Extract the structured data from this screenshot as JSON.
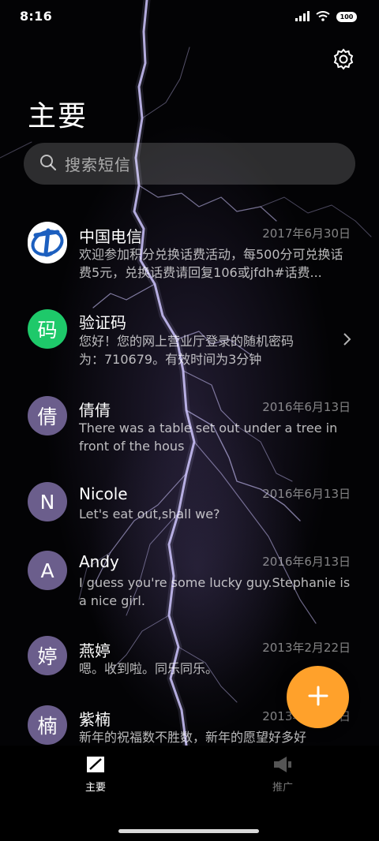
{
  "status_bar": {
    "time": "8:16",
    "battery": "100"
  },
  "header": {
    "title": "主要"
  },
  "search": {
    "placeholder": "搜索短信"
  },
  "messages": [
    {
      "sender": "中国电信",
      "date": "2017年6月30日",
      "preview": "欢迎参加积分兑换话费活动，每500分可兑换话费5元，兑换话费请回复106或jfdh#话费...",
      "avatar_icon": "china-telecom-logo",
      "avatar_color": "#ffffff"
    },
    {
      "sender": "验证码",
      "date": "",
      "preview": "您好！您的网上营业厅登录的随机密码为：710679。有效时间为3分钟",
      "avatar_text": "码",
      "avatar_color": "#1ec96a"
    },
    {
      "sender": "倩倩",
      "date": "2016年6月13日",
      "preview": "There was a table set out under a tree in front of the hous",
      "avatar_text": "倩",
      "avatar_color": "#6b5e8c"
    },
    {
      "sender": "Nicole",
      "date": "2016年6月13日",
      "preview": "Let's eat out,shall we?",
      "avatar_text": "N",
      "avatar_color": "#6b5e8c"
    },
    {
      "sender": "Andy",
      "date": "2016年6月13日",
      "preview": "I guess you're some lucky guy.Stephanie is a nice girl.",
      "avatar_text": "A",
      "avatar_color": "#6b5e8c"
    },
    {
      "sender": "燕婷",
      "date": "2013年2月22日",
      "preview": "嗯。收到啦。同乐同乐。",
      "avatar_text": "婷",
      "avatar_color": "#6b5e8c"
    },
    {
      "sender": "紫楠",
      "date": "2013年2月22日",
      "preview": "新年的祝福数不胜数，新年的愿望好多好",
      "avatar_text": "楠",
      "avatar_color": "#6b5e8c"
    }
  ],
  "fab": {
    "icon": "plus-icon",
    "color": "#ffa12b"
  },
  "bottom_nav": [
    {
      "label": "主要",
      "icon": "chat-icon",
      "active": true
    },
    {
      "label": "推广",
      "icon": "megaphone-icon",
      "active": false
    }
  ]
}
